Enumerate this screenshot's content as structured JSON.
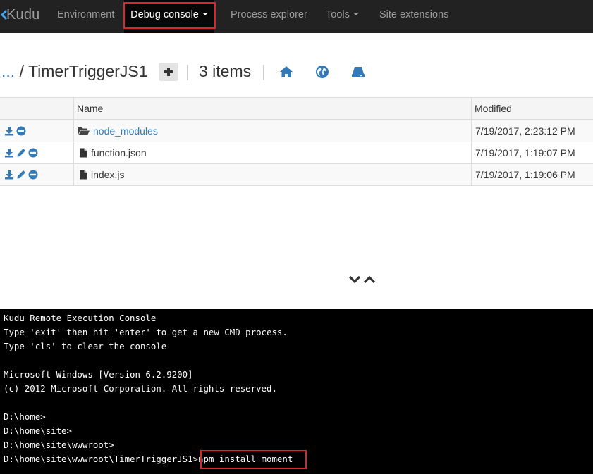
{
  "navbar": {
    "brand": "Kudu",
    "items": [
      {
        "label": "Environment"
      },
      {
        "label": "Debug console",
        "has_caret": true,
        "active": true
      },
      {
        "label": "Process explorer"
      },
      {
        "label": "Tools",
        "has_caret": true
      },
      {
        "label": "Site extensions"
      }
    ]
  },
  "breadcrumb": {
    "ellipsis": "...",
    "slash": "/",
    "folder": "TimerTriggerJS1",
    "separator": "|",
    "item_count": "3 items"
  },
  "header_icons": [
    "home-icon",
    "globe-icon",
    "drive-icon"
  ],
  "file_table": {
    "columns": [
      "",
      "Name",
      "Modified"
    ],
    "rows": [
      {
        "name": "node_modules",
        "type": "folder",
        "modified": "7/19/2017, 2:23:12 PM",
        "actions": [
          "download",
          "delete"
        ]
      },
      {
        "name": "function.json",
        "type": "file",
        "modified": "7/19/2017, 1:19:07 PM",
        "actions": [
          "download",
          "edit",
          "delete"
        ]
      },
      {
        "name": "index.js",
        "type": "file",
        "modified": "7/19/2017, 1:19:06 PM",
        "actions": [
          "download",
          "edit",
          "delete"
        ]
      }
    ]
  },
  "console": {
    "lines": [
      "Kudu Remote Execution Console",
      "Type 'exit' then hit 'enter' to get a new CMD process.",
      "Type 'cls' to clear the console",
      "",
      "Microsoft Windows [Version 6.2.9200]",
      "(c) 2012 Microsoft Corporation. All rights reserved.",
      "",
      "D:\\home>",
      "D:\\home\\site>",
      "D:\\home\\site\\wwwroot>"
    ],
    "prompt": "D:\\home\\site\\wwwroot\\TimerTriggerJS1>",
    "command": "npm install moment"
  },
  "colors": {
    "navbar_bg": "#222222",
    "link": "#337ab7",
    "highlight": "#d9262f",
    "console_bg": "#000000"
  }
}
